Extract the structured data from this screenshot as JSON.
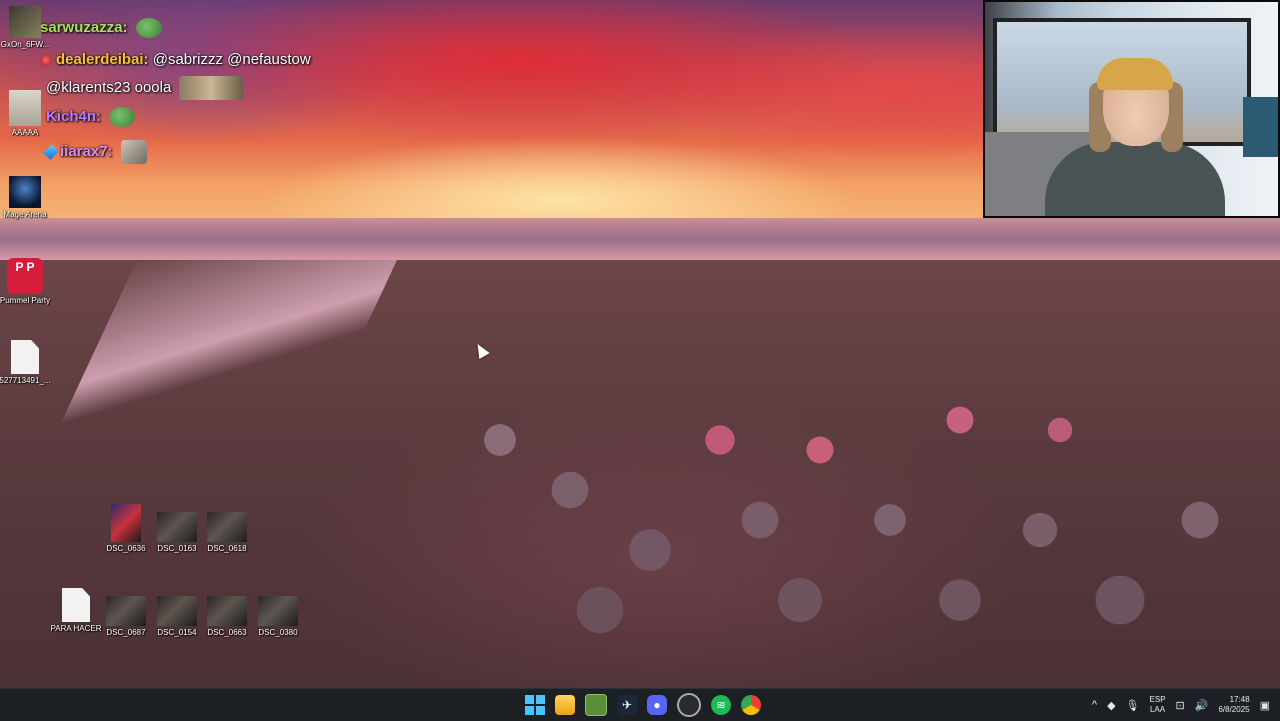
{
  "chat": {
    "lines": [
      {
        "user": "sarwuzazza:",
        "user_color": "#a8e060",
        "msg": "",
        "emote": "frog"
      },
      {
        "user": "dealerdeibai:",
        "user_color": "#f5c23a",
        "msg": "@sabrizzz @nefaustow",
        "emote": "",
        "badge": "red"
      },
      {
        "user": "",
        "user_color": "#ffffff",
        "msg": "@klarents23 ooola",
        "emote": "img"
      },
      {
        "user": "Kich4n:",
        "user_color": "#b77cff",
        "msg": "",
        "emote": "frog"
      },
      {
        "user": "iiarax7:",
        "user_color": "#d98cf2",
        "msg": "",
        "emote": "cat",
        "badge": "gem"
      }
    ]
  },
  "desktop_icons": [
    {
      "label": "GxOn_6FW...",
      "glyph": "avatar"
    },
    {
      "label": "AAAAA",
      "glyph": "aaaa"
    },
    {
      "label": "Mage Arena",
      "glyph": "mage"
    },
    {
      "label": "Pummel Party",
      "glyph": "pummel",
      "glyph_text": "P P"
    },
    {
      "label": "527713491_...",
      "glyph": "file"
    },
    {
      "label": "DSC_0636",
      "glyph": "photo-red"
    },
    {
      "label": "DSC_0163",
      "glyph": "photo"
    },
    {
      "label": "DSC_0618",
      "glyph": "photo"
    },
    {
      "label": "PARA HACER",
      "glyph": "file"
    },
    {
      "label": "DSC_0687",
      "glyph": "photo"
    },
    {
      "label": "DSC_0154",
      "glyph": "photo"
    },
    {
      "label": "DSC_0663",
      "glyph": "photo"
    },
    {
      "label": "DSC_0380",
      "glyph": "photo"
    }
  ],
  "taskbar": {
    "apps": [
      {
        "name": "start",
        "icon": "windows-logo"
      },
      {
        "name": "file-explorer",
        "icon": "folder-icon"
      },
      {
        "name": "xbox",
        "icon": "xbox-icon"
      },
      {
        "name": "steam",
        "icon": "steam-icon"
      },
      {
        "name": "discord",
        "icon": "discord-icon"
      },
      {
        "name": "obs",
        "icon": "obs-icon"
      },
      {
        "name": "spotify",
        "icon": "spotify-icon"
      },
      {
        "name": "chrome",
        "icon": "chrome-icon"
      }
    ],
    "tray": {
      "chevron": "^",
      "lang_top": "ESP",
      "lang_bottom": "LAA",
      "time": "17:48",
      "date": "6/8/2025"
    }
  },
  "colors": {
    "taskbar_bg": "#1c1f24",
    "accent": "#4cc2ff"
  }
}
